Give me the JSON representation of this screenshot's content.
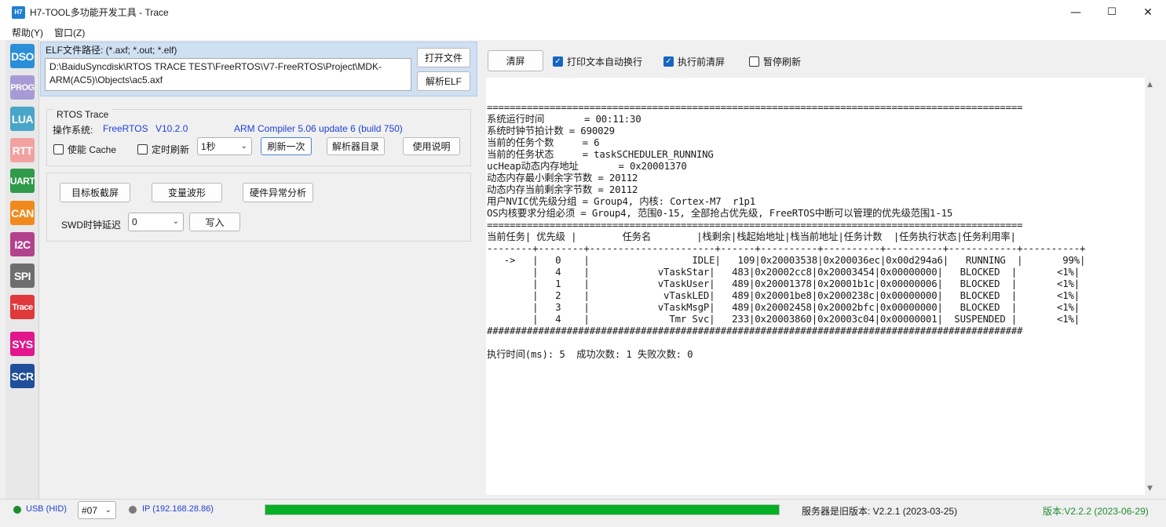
{
  "window": {
    "icon_text": "H7",
    "title": "H7-TOOL多功能开发工具 - Trace",
    "minimize": "—",
    "maximize": "☐",
    "close": "✕"
  },
  "menu": [
    "帮助(Y)",
    "窗口(Z)"
  ],
  "rail": [
    {
      "label": "DSO",
      "color": "#2a8fd8"
    },
    {
      "label": "PROG",
      "color": "#a79bd6"
    },
    {
      "label": "LUA",
      "color": "#4aa6c8"
    },
    {
      "label": "RTT",
      "color": "#f2a1a0"
    },
    {
      "label": "UART",
      "color": "#2f9a4a"
    },
    {
      "label": "CAN",
      "color": "#f08a1c"
    },
    {
      "label": "I2C",
      "color": "#b3428e"
    },
    {
      "label": "SPI",
      "color": "#6e6e6e"
    },
    {
      "label": "Trace",
      "color": "#e0383b"
    },
    {
      "label": "SYS",
      "color": "#e2168d"
    },
    {
      "label": "SCR",
      "color": "#1f4f9a"
    }
  ],
  "elf": {
    "label": "ELF文件路径: (*.axf; *.out; *.elf)",
    "path": "D:\\BaiduSyncdisk\\RTOS TRACE TEST\\FreeRTOS\\V7-FreeRTOS\\Project\\MDK-ARM(AC5)\\Objects\\ac5.axf",
    "open_button": "打开文件",
    "parse_button": "解析ELF"
  },
  "rtos": {
    "group_title": "RTOS Trace",
    "os_label": "操作系统:",
    "os_name": "FreeRTOS",
    "os_version": "V10.2.0",
    "compiler": "ARM Compiler 5.06 update 6 (build 750)",
    "cache_label": "使能 Cache",
    "cache_checked": false,
    "timer_label": "定时刷新",
    "timer_checked": false,
    "interval": "1秒",
    "refresh_button": "刷新一次",
    "parser_dir_button": "解析器目录",
    "help_button": "使用说明"
  },
  "tools": {
    "screenshot_button": "目标板截屏",
    "wave_button": "变量波形",
    "fault_button": "硬件异常分析",
    "swd_label": "SWD时钟延迟",
    "swd_value": "0",
    "write_button": "写入"
  },
  "console_toolbar": {
    "clear_button": "清屏",
    "wrap_label": "打印文本自动换行",
    "wrap_checked": true,
    "clear_before_label": "执行前清屏",
    "clear_before_checked": true,
    "pause_label": "暂停刷新",
    "pause_checked": false
  },
  "console": {
    "sep_eq": "==============================================================================================",
    "info": [
      "系统运行时间       = 00:11:30",
      "系统时钟节拍计数 = 690029",
      "当前的任务个数     = 6",
      "当前的任务状态     = taskSCHEDULER_RUNNING",
      "ucHeap动态内存地址       = 0x20001370",
      "动态内存最小剩余字节数 = 20112",
      "动态内存当前剩余字节数 = 20112",
      "用户NVIC优先级分组 = Group4, 内核: Cortex-M7  r1p1",
      "OS内核要求分组必须 = Group4, 范围0-15, 全部抢占优先级, FreeRTOS中断可以管理的优先级范围1-15"
    ],
    "table_header": "当前任务| 优先级 |        任务名        |栈剩余|栈起始地址|栈当前地址|任务计数  |任务执行状态|任务利用率|",
    "table_sep": "--------+--------+----------------------+------+----------+----------+----------+------------+----------+",
    "rows": [
      "   ->   |   0    |                  IDLE|   109|0x20003538|0x200036ec|0x00d294a6|   RUNNING  |       99%|",
      "        |   4    |            vTaskStar|   483|0x20002cc8|0x20003454|0x00000000|   BLOCKED  |       <1%|",
      "        |   1    |            vTaskUser|   489|0x20001378|0x20001b1c|0x00000006|   BLOCKED  |       <1%|",
      "        |   2    |             vTaskLED|   489|0x20001be8|0x2000238c|0x00000000|   BLOCKED  |       <1%|",
      "        |   3    |            vTaskMsgP|   489|0x20002458|0x20002bfc|0x00000000|   BLOCKED  |       <1%|",
      "        |   4    |              Tmr Svc|   233|0x20003860|0x20003c04|0x00000001|  SUSPENDED |       <1%|"
    ],
    "sep_hash": "##############################################################################################",
    "summary": "执行时间(ms): 5  成功次数: 1 失败次数: 0"
  },
  "status": {
    "usb_label": "USB (HID)",
    "device": "#07",
    "ip_label": "IP (192.168.28.86)",
    "progress": 1.0,
    "server_version": "服务器是旧版本: V2.2.1 (2023-03-25)",
    "local_version": "版本:V2.2.2 (2023-06-29)"
  }
}
